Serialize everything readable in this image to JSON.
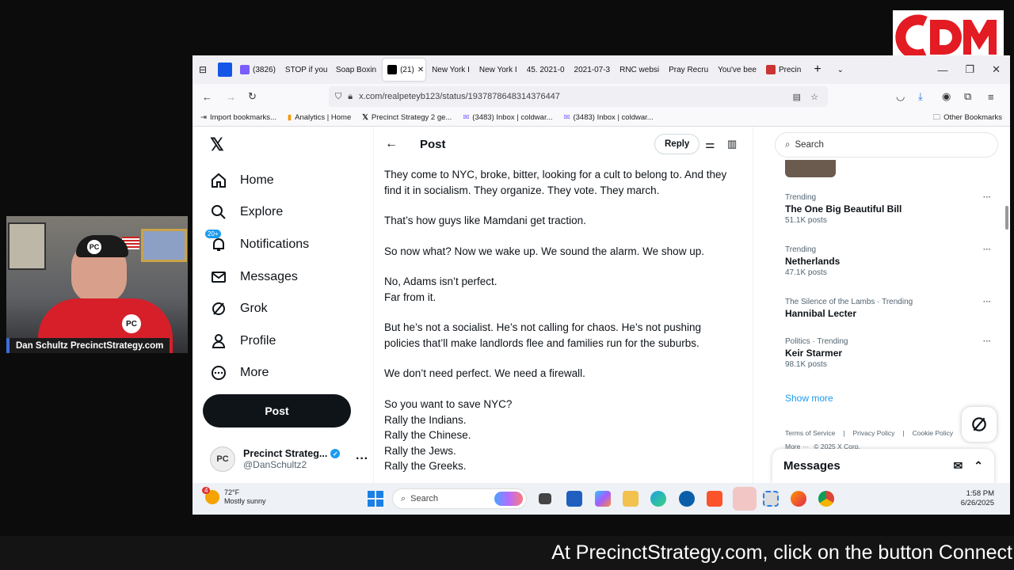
{
  "browser": {
    "tabs": [
      "(3826)",
      "STOP if you",
      "Soap Boxin",
      "(21)",
      "New York I",
      "New York I",
      "45. 2021-0",
      "2021-07-3",
      "RNC websi",
      "Pray Recru",
      "You've bee",
      "Precin"
    ],
    "url": "x.com/realpeteyb123/status/1937878648314376447",
    "bookmarks": [
      "Import bookmarks...",
      "Analytics | Home",
      "Precinct Strategy 2 ge...",
      "(3483) Inbox | coldwar...",
      "(3483) Inbox | coldwar..."
    ],
    "other_bookmarks": "Other Bookmarks"
  },
  "nav": {
    "items": [
      "Home",
      "Explore",
      "Notifications",
      "Messages",
      "Grok",
      "Profile",
      "More"
    ],
    "notif_badge": "20+",
    "post_button": "Post",
    "account_name": "Precinct Strateg...",
    "account_handle": "@DanSchultz2",
    "avatar_text": "PC"
  },
  "post": {
    "header": "Post",
    "reply_button": "Reply",
    "paragraphs": [
      [
        "They come to NYC, broke, bitter, looking for a cult to belong to. And they",
        "find it in socialism. They organize. They vote. They march."
      ],
      [
        "That’s how guys like Mamdani get traction."
      ],
      [
        "So now what? Now we wake up. We sound the alarm. We show up."
      ],
      [
        "No, Adams isn’t perfect.",
        "Far from it."
      ],
      [
        "But he’s not a socialist. He’s not calling for chaos. He’s not pushing",
        "policies that’ll make landlords flee and families run for the suburbs."
      ],
      [
        "We don’t need perfect. We need a firewall."
      ],
      [
        "So you want to save NYC?",
        "Rally the Indians.",
        "Rally the Chinese.",
        "Rally the Jews.",
        "Rally the Greeks."
      ]
    ]
  },
  "sidebar": {
    "search_placeholder": "Search",
    "trends": [
      {
        "context": "Trending",
        "title": "The One Big Beautiful Bill",
        "count": "51.1K posts"
      },
      {
        "context": "Trending",
        "title": "Netherlands",
        "count": "47.1K posts"
      },
      {
        "context": "The Silence of the Lambs · Trending",
        "title": "Hannibal Lecter",
        "count": ""
      },
      {
        "context": "Politics · Trending",
        "title": "Keir Starmer",
        "count": "98.1K posts"
      }
    ],
    "show_more": "Show more",
    "footer": [
      "Terms of Service",
      "Privacy Policy",
      "Cookie Policy",
      "More ···",
      "© 2025 X Corp."
    ],
    "messages": "Messages"
  },
  "taskbar": {
    "weather_temp": "72°F",
    "weather_desc": "Mostly sunny",
    "weather_badge": "4",
    "search": "Search",
    "time": "1:58 PM",
    "date": "6/26/2025"
  },
  "webcam": {
    "label": "Dan Schultz PrecinctStrategy.com"
  },
  "caption": "At PrecinctStrategy.com, click on the button Connect",
  "logo": "CDM",
  "colors": {
    "x_blue": "#1d9bf0",
    "dark": "#0f1419",
    "logo_red": "#e31b23"
  }
}
